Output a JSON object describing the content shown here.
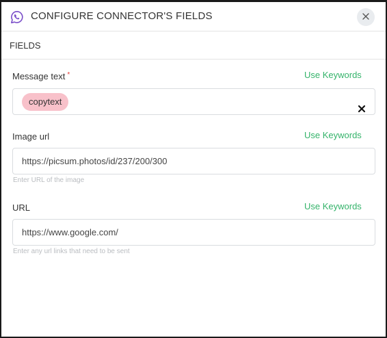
{
  "header": {
    "title": "CONFIGURE CONNECTOR'S FIELDS",
    "app_icon": "whatsapp-icon",
    "close_icon": "close-icon"
  },
  "section": {
    "label": "FIELDS"
  },
  "fields": [
    {
      "label": "Message text",
      "required_marker": "*",
      "keywords_link": "Use Keywords",
      "chips": [
        "copytext"
      ],
      "clear_icon": "clear-icon"
    },
    {
      "label": "Image url",
      "keywords_link": "Use Keywords",
      "value": "https://picsum.photos/id/237/200/300",
      "helper": "Enter URL of the image"
    },
    {
      "label": "URL",
      "keywords_link": "Use Keywords",
      "value": "https://www.google.com/",
      "helper": "Enter any url links that need to be sent"
    }
  ],
  "colors": {
    "accent_green": "#34b36a",
    "chip_pink": "#f8c1ca",
    "required_red": "#e53935",
    "icon_purple": "#7b4fc9"
  }
}
